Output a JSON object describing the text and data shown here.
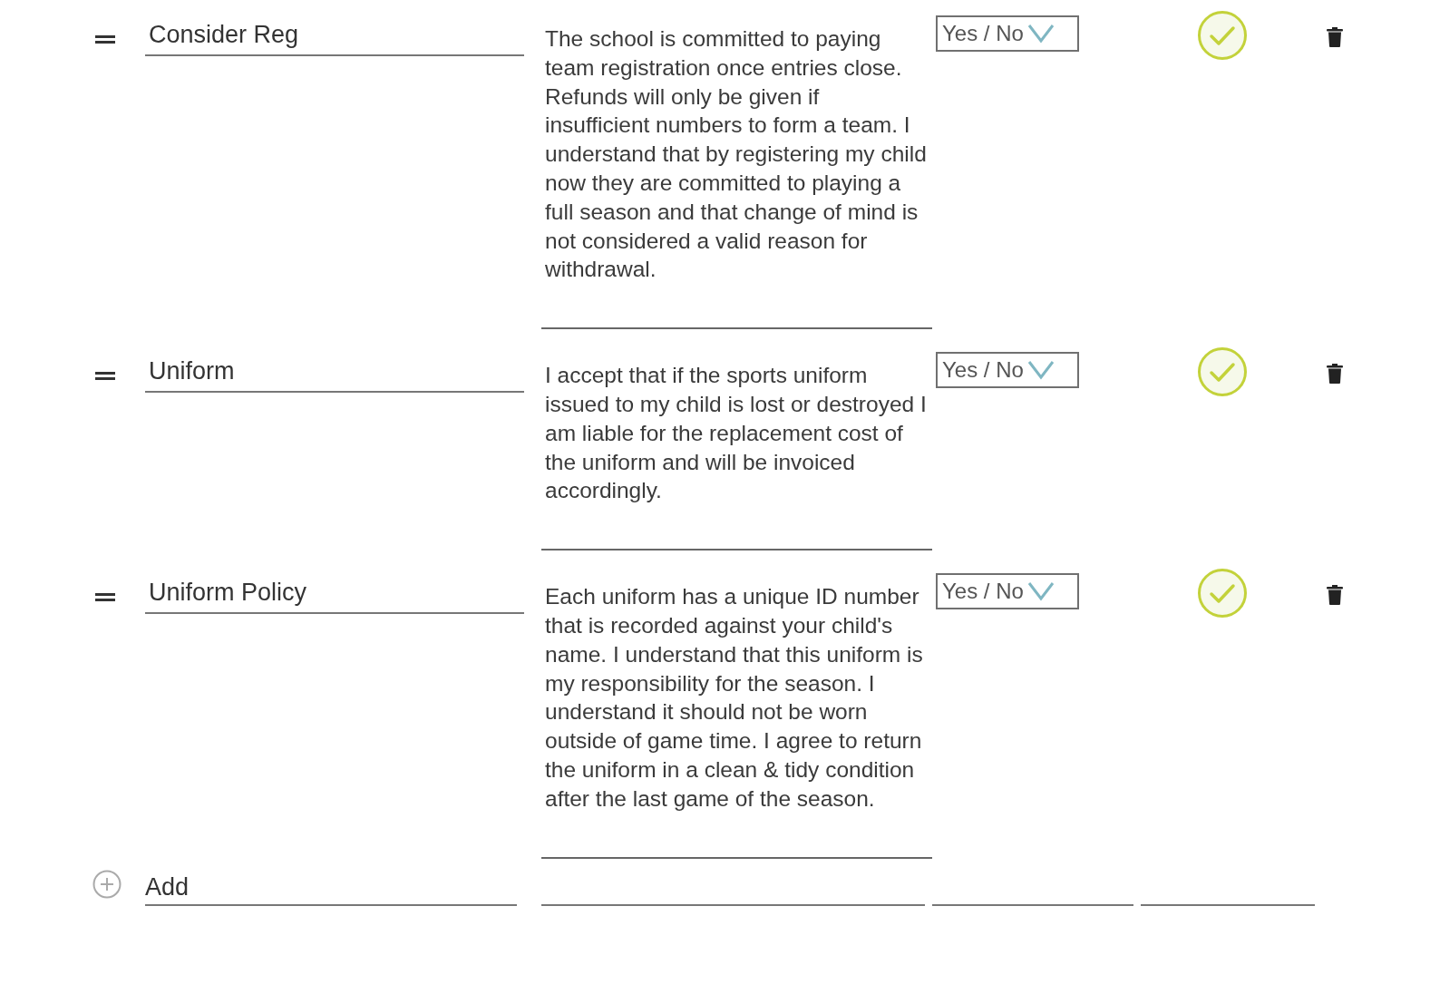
{
  "items": [
    {
      "name": "Consider Reg",
      "description": "The school is committed to paying team registration once entries close. Refunds will only be given if insufficient numbers to form a team. I understand that by registering my child now they are committed to playing a full season and that change of mind is not considered a valid reason for withdrawal.",
      "answer_type": "Yes / No",
      "required": true
    },
    {
      "name": "Uniform",
      "description": "I accept that if the sports uniform issued to my child is lost or destroyed I am liable for the replacement cost of the uniform and will be invoiced accordingly.",
      "answer_type": "Yes / No",
      "required": true
    },
    {
      "name": "Uniform Policy",
      "description": "Each uniform has a unique ID number that is recorded against your child's name. I understand that this uniform is my responsibility for the season. I understand it should not be worn outside of game time. I agree to return the uniform in a clean & tidy condition after the last game of the season.",
      "answer_type": "Yes / No",
      "required": true
    }
  ],
  "add_label": "Add"
}
